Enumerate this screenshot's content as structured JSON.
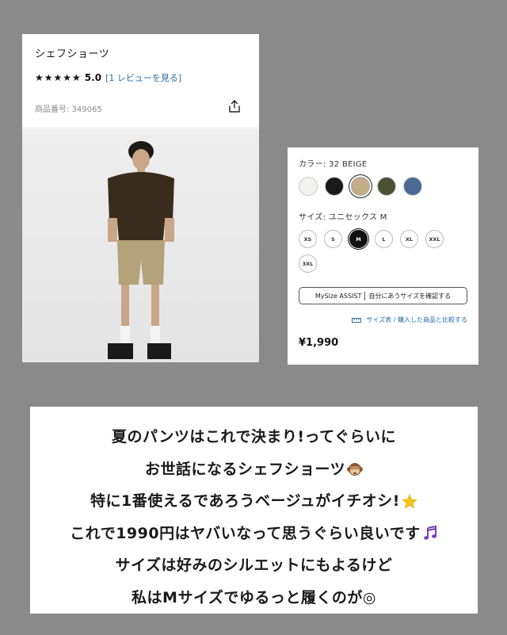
{
  "product": {
    "title": "シェフショーツ",
    "stars": "★★★★★",
    "score": "5.0",
    "review_link": "[1 レビューを見る]",
    "product_no_label": "商品番号:",
    "product_no": "349065",
    "color_label": "カラー: 32 BEIGE",
    "swatches": [
      {
        "name": "white",
        "color": "#f1f1ef"
      },
      {
        "name": "black",
        "color": "#1a1a1a"
      },
      {
        "name": "beige",
        "color": "#c2ad86",
        "selected": true
      },
      {
        "name": "olive",
        "color": "#4a5032"
      },
      {
        "name": "blue",
        "color": "#4b6a94"
      }
    ],
    "size_label": "サイズ: ユニセックス M",
    "sizes": [
      "XS",
      "S",
      "M",
      "L",
      "XL",
      "XXL",
      "3XL"
    ],
    "selected_size": "M",
    "mysize_left": "MySize ASSIST",
    "mysize_right": "自分にあうサイズを確認する",
    "size_chart_link": "サイズ表 / 購入した商品と比較する",
    "price": "¥1,990"
  },
  "text": {
    "lines": [
      "夏のパンツはこれで決まり!ってぐらいに",
      "お世話になるシェフショーツ",
      "特に1番使えるであろうベージュがイチオシ!",
      "これで1990円はヤバいなって思うぐらい良いです",
      "サイズは好みのシルエットにもよるけど",
      "私はMサイズでゆるっと履くのが◎"
    ]
  },
  "icons": {
    "share": "share-icon",
    "monkey": "see-no-evil-monkey-icon",
    "star": "star-emoji-icon",
    "music": "music-notes-icon",
    "ruler": "ruler-icon"
  }
}
